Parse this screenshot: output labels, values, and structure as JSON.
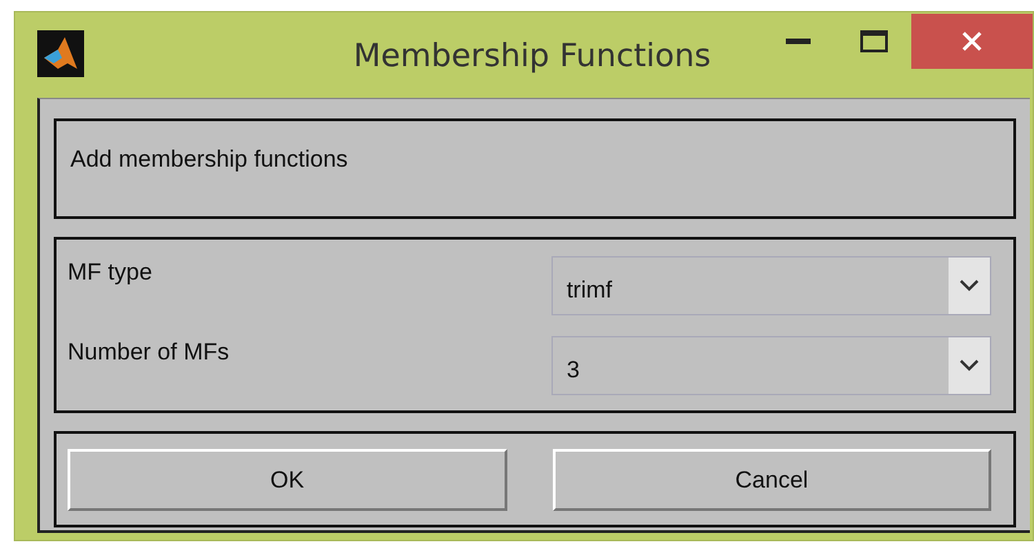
{
  "window": {
    "title": "Membership Functions"
  },
  "header": {
    "text": "Add membership functions"
  },
  "fields": [
    {
      "label": "MF type",
      "value": "trimf"
    },
    {
      "label": "Number of MFs",
      "value": "3"
    }
  ],
  "buttons": [
    {
      "label": "OK"
    },
    {
      "label": "Cancel"
    }
  ]
}
